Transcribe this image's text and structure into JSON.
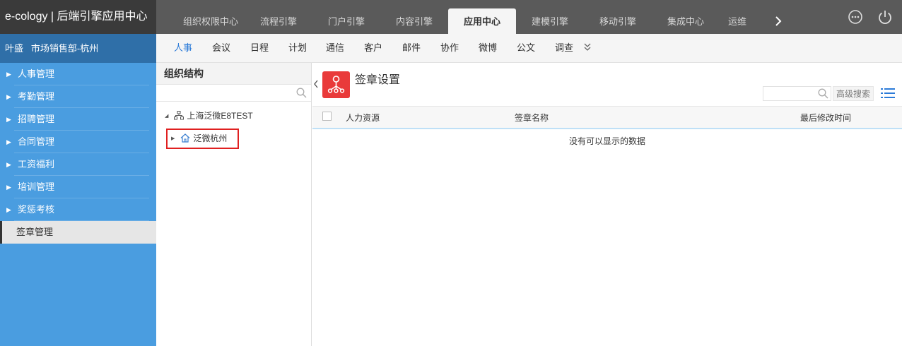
{
  "app": {
    "brand": "e-cology | 后端引擎应用中心"
  },
  "topnav": {
    "items": [
      "组织权限中心",
      "流程引擎",
      "门户引擎",
      "内容引擎",
      "应用中心",
      "建模引擎",
      "移动引擎",
      "集成中心",
      "运维"
    ],
    "active": "应用中心"
  },
  "user": {
    "name": "叶盛",
    "dept": "市场销售部-杭州"
  },
  "sidebar": {
    "items": [
      {
        "label": "人事管理"
      },
      {
        "label": "考勤管理"
      },
      {
        "label": "招聘管理"
      },
      {
        "label": "合同管理"
      },
      {
        "label": "工资福利"
      },
      {
        "label": "培训管理"
      },
      {
        "label": "奖惩考核"
      },
      {
        "label": "签章管理"
      }
    ],
    "active": "签章管理"
  },
  "subnav": {
    "items": [
      "人事",
      "会议",
      "日程",
      "计划",
      "通信",
      "客户",
      "邮件",
      "协作",
      "微博",
      "公文",
      "调查"
    ],
    "active": "人事"
  },
  "tree": {
    "title": "组织结构",
    "search_value": "",
    "root": {
      "label": "上海泛微E8TEST",
      "icon": "org-structure-icon"
    },
    "child": {
      "label": "泛微杭州",
      "icon": "home-icon"
    }
  },
  "main": {
    "title": "签章设置",
    "logo_icon": "org-tree-icon",
    "search_value": "",
    "advanced_search": "高级搜索",
    "columns": [
      "人力资源",
      "签章名称",
      "最后修改时间"
    ],
    "empty_message": "没有可以显示的数据"
  },
  "colors": {
    "topbar": "#5a5a5a",
    "brand_bg": "#3a3a3a",
    "userbar": "#2f6fa8",
    "sidebar": "#4a9de0",
    "accent": "#2c7bd8",
    "logo_red": "#e93a3a",
    "highlight_border": "#e02020"
  }
}
